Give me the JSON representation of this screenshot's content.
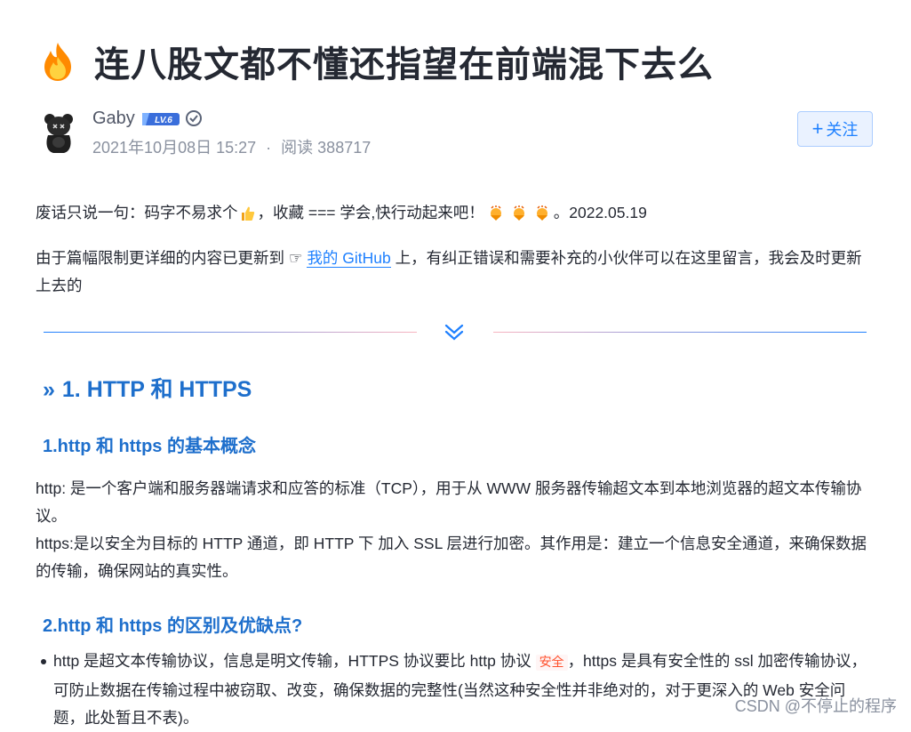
{
  "article": {
    "title": "连八股文都不懂还指望在前端混下去么",
    "author": {
      "name": "Gaby",
      "level": "LV.6",
      "date": "2021年10月08日 15:27",
      "separator": "·",
      "reads": "阅读 388717",
      "follow_label": "关注",
      "follow_plus": "+"
    },
    "intro": {
      "line1_a": "废话只说一句：码字不易求个",
      "line1_b": "，收藏 === 学会,快行动起来吧！",
      "line1_c": "。2022.05.19",
      "line2_a": "由于篇幅限制更详细的内容已更新到 ☞ ",
      "line2_link": "我的 GitHub",
      "line2_b": " 上，有纠正错误和需要补充的小伙伴可以在这里留言，我会及时更新上去的"
    },
    "h1": {
      "arrow": "»",
      "text": "1. HTTP 和 HTTPS"
    },
    "h2_a": "1.http 和 https 的基本概念",
    "para_http": "http: 是一个客户端和服务器端请求和应答的标准（TCP），用于从 WWW 服务器传输超文本到本地浏览器的超文本传输协议。",
    "para_https": "https:是以安全为目标的 HTTP 通道，即 HTTP 下 加入 SSL 层进行加密。其作用是：建立一个信息安全通道，来确保数据的传输，确保网站的真实性。",
    "h2_b": "2.http 和 https 的区别及优缺点?",
    "bullet1_a": "http 是超文本传输协议，信息是明文传输，HTTPS 协议要比 http 协议 ",
    "bullet1_code": "安全",
    "bullet1_b": "，https 是具有安全性的 ssl 加密传输协议，可防止数据在传输过程中被窃取、改变，确保数据的完整性(当然这种安全性并非绝对的，对于更深入的 Web 安全问题，此处暂且不表)。"
  },
  "watermark": "CSDN @不停止的程序",
  "colors": {
    "accent": "#1e80ff",
    "heading": "#1e6fcc",
    "text": "#252933",
    "muted": "#8a919f"
  },
  "icons": [
    "fire-icon",
    "avatar-icon",
    "level-badge-icon",
    "verified-icon",
    "thumbs-up-icon",
    "celebrate-icon",
    "double-chevron-down-icon"
  ]
}
